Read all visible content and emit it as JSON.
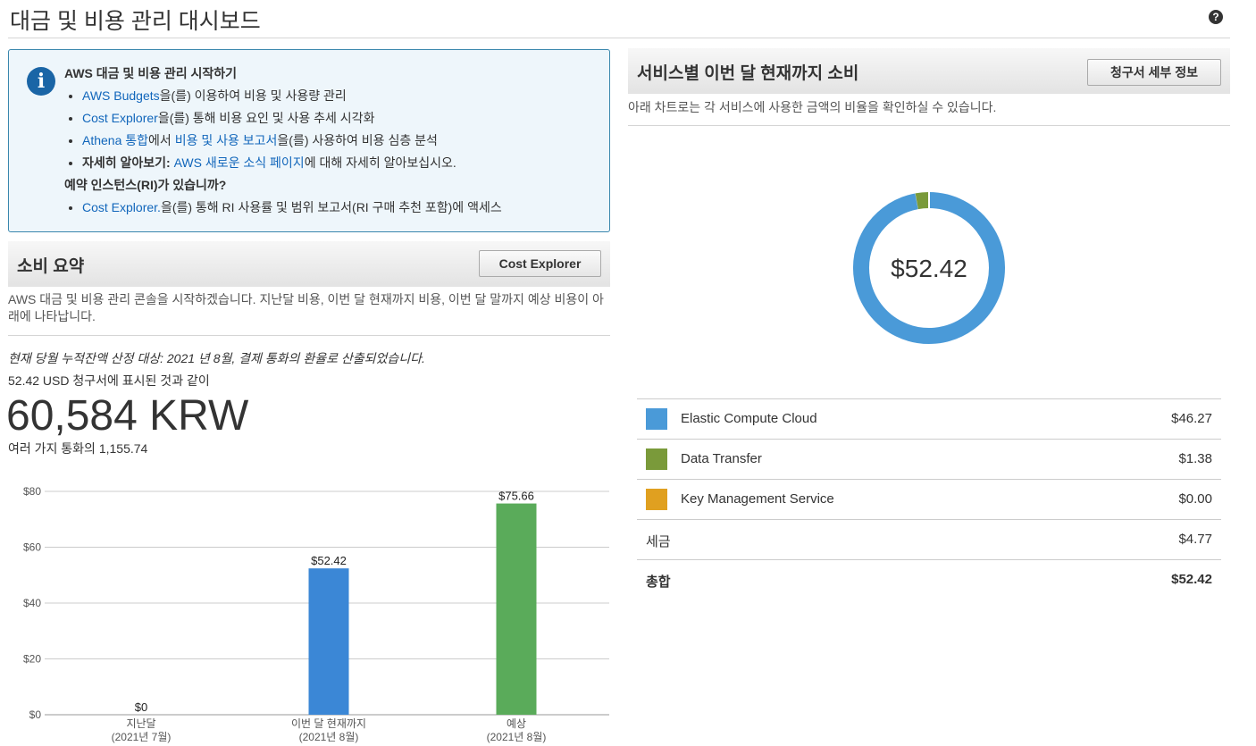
{
  "page": {
    "title": "대금 및 비용 관리 대시보드",
    "help_icon": "question-circle-icon"
  },
  "info_box": {
    "icon": "info-circle-icon",
    "heading": "AWS 대금 및 비용 관리 시작하기",
    "items": [
      {
        "link": "AWS Budgets",
        "text": "을(를) 이용하여 비용 및 사용량 관리"
      },
      {
        "link": "Cost Explorer",
        "text": "을(를) 통해 비용 요인 및 사용 추세 시각화"
      },
      {
        "link": "Athena 통합",
        "text": "에서 ",
        "link2": "비용 및 사용 보고서",
        "text2": "을(를) 사용하여 비용 심층 분석"
      },
      {
        "bold": "자세히 알아보기:",
        "link": "AWS 새로운 소식 페이지",
        "text": "에 대해 자세히 알아보십시오."
      }
    ],
    "ri_heading": "예약 인스턴스(RI)가 있습니까?",
    "ri_item": {
      "link": "Cost Explorer.",
      "text": "을(를) 통해 RI 사용률 및 범위 보고서(RI 구매 추천 포함)에 액세스"
    }
  },
  "spend_summary": {
    "title": "소비 요약",
    "button_label": "Cost Explorer",
    "description": "AWS 대금 및 비용 관리 콘솔을 시작하겠습니다. 지난달 비용, 이번 달 현재까지 비용, 이번 달 말까지 예상 비용이 아래에 나타납니다.",
    "accrual_note": "현재 당월 누적잔액 산정 대상: 2021 년 8월, 결제 통화의 환율로 산출되었습니다.",
    "usd_line": "52.42 USD 청구서에 표시된 것과 같이",
    "amount": "60,584 KRW",
    "multi_currency": "여러 가지 통화의 1,155.74"
  },
  "chart_data": {
    "type": "bar",
    "categories": [
      {
        "line1": "지난달",
        "line2": "(2021년 7월)"
      },
      {
        "line1": "이번 달 현재까지",
        "line2": "(2021년 8월)"
      },
      {
        "line1": "예상",
        "line2": "(2021년 8월)"
      }
    ],
    "values": [
      0,
      52.42,
      75.66
    ],
    "value_labels": [
      "$0",
      "$52.42",
      "$75.66"
    ],
    "colors": [
      "#3b87d6",
      "#3b87d6",
      "#5aab5a"
    ],
    "yticks": [
      "$0",
      "$20",
      "$40",
      "$60",
      "$80"
    ],
    "ylim": [
      0,
      80
    ],
    "grid": true
  },
  "service_spend": {
    "title": "서비스별 이번 달 현재까지 소비",
    "button_label": "청구서 세부 정보",
    "note": "아래 차트로는 각 서비스에 사용한 금액의 비율을 확인하실 수 있습니다.",
    "donut_center": "$52.42",
    "services": [
      {
        "name": "Elastic Compute Cloud",
        "value": "$46.27",
        "amount": 46.27,
        "color": "#4a9ad8"
      },
      {
        "name": "Data Transfer",
        "value": "$1.38",
        "amount": 1.38,
        "color": "#7a9a3a"
      },
      {
        "name": "Key Management Service",
        "value": "$0.00",
        "amount": 0.0,
        "color": "#e0a020"
      }
    ],
    "tax": {
      "label": "세금",
      "value": "$4.77"
    },
    "total": {
      "label": "총합",
      "value": "$52.42"
    }
  }
}
